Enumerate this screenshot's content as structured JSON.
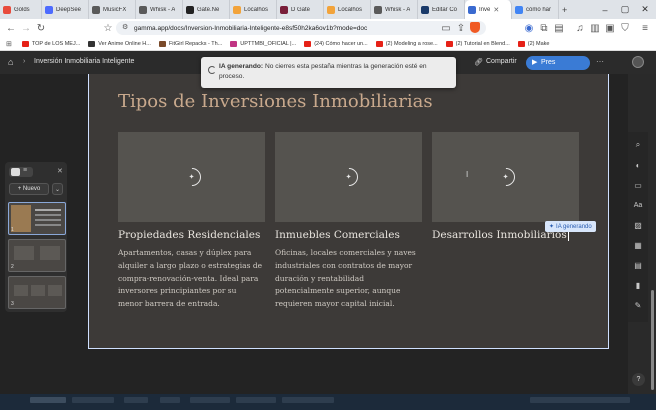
{
  "browser": {
    "tabs": [
      {
        "label": "Golds",
        "color": "#e84b3c"
      },
      {
        "label": "DeepSee",
        "color": "#4d6bfe"
      },
      {
        "label": "MusicFX",
        "color": "#5a5a5a"
      },
      {
        "label": "Whisk - A",
        "color": "#5a5a5a"
      },
      {
        "label": "Gate.Ne",
        "color": "#222222"
      },
      {
        "label": "Localhos",
        "color": "#f2a33a"
      },
      {
        "label": "D Gate",
        "color": "#7a1f3a"
      },
      {
        "label": "Localhos",
        "color": "#f2a33a"
      },
      {
        "label": "Whisk - A",
        "color": "#5a5a5a"
      },
      {
        "label": "Editar Co",
        "color": "#1a3a6a"
      },
      {
        "label": "Inve",
        "color": "#3a6ad0"
      },
      {
        "label": "cómo har",
        "color": "#4285f4"
      }
    ],
    "active_tab": 10,
    "url": "gamma.app/docs/Inversion-Inmobiliaria-Inteligente-e8sf50h2ka6ov1b?mode=doc",
    "bookmarks": [
      {
        "label": "TOP de LOS MEJ...",
        "color": "#e62117"
      },
      {
        "label": "Ver Anime Online H...",
        "color": "#333333"
      },
      {
        "label": "FitGirl Repacks - Th...",
        "color": "#7a4a2a"
      },
      {
        "label": "UPTTMBI_OFICIAL |...",
        "color": "#c13584"
      },
      {
        "label": "(24) Cómo hacer un...",
        "color": "#e62117"
      },
      {
        "label": "(2) Modeling a rose...",
        "color": "#e62117"
      },
      {
        "label": "(2) Tutorial en Blend...",
        "color": "#e62117"
      },
      {
        "label": "(2) Make",
        "color": "#e62117"
      }
    ]
  },
  "header": {
    "breadcrumb": "Inversión Inmobiliaria Inteligente",
    "share_label": "Compartir",
    "present_label": "Pres"
  },
  "toast": {
    "bold": "IA generando:",
    "text": "No cierres esta pestaña mientras la generación esté en proceso."
  },
  "slidepanel": {
    "new_label": "+ Nuevo",
    "thumbs": [
      "1",
      "2",
      "3"
    ]
  },
  "card": {
    "title": "Tipos de Inversiones Inmobiliarias",
    "columns": [
      {
        "title": "Propiedades Residenciales",
        "body": "Apartamentos, casas y dúplex para alquiler a largo plazo o estrategias de compra-renovación-venta. Ideal para inversores principiantes por su menor barrera de entrada."
      },
      {
        "title": "Inmuebles Comerciales",
        "body": "Oficinas, locales comerciales y naves industriales con contratos de mayor duración y rentabilidad potencialmente superior, aunque requieren mayor capital inicial."
      },
      {
        "title": "Desarrollos Inmobiliarios",
        "body": ""
      }
    ],
    "ai_badge": "IA generando"
  },
  "colors": {
    "title": "#c9a98d",
    "accent": "#3a7bd5",
    "card_bg": "#3d3a38"
  }
}
